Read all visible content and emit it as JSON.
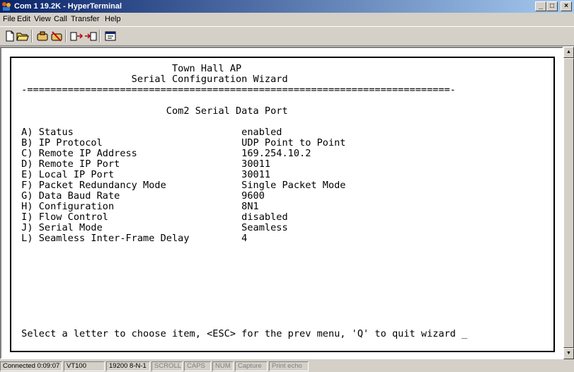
{
  "window": {
    "title": "Com 1 19.2K - HyperTerminal",
    "minimize_glyph": "_",
    "maximize_glyph": "□",
    "close_glyph": "×"
  },
  "menu": [
    "File",
    "Edit",
    "View",
    "Call",
    "Transfer",
    "Help"
  ],
  "toolbar": {
    "buttons": [
      "new-icon",
      "open-icon",
      "connect-icon",
      "disconnect-icon",
      "send-icon",
      "receive-icon",
      "properties-icon"
    ]
  },
  "terminal": {
    "lines": [
      "                           Town Hall AP",
      "                    Serial Configuration Wizard",
      " -=========================================================================-",
      "",
      "                          Com2 Serial Data Port",
      "",
      " A) Status                             enabled",
      " B) IP Protocol                        UDP Point to Point",
      " C) Remote IP Address                  169.254.10.2",
      " D) Remote IP Port                     30011",
      " E) Local IP Port                      30011",
      " F) Packet Redundancy Mode             Single Packet Mode",
      " G) Data Baud Rate                     9600",
      " H) Configuration                      8N1",
      " I) Flow Control                       disabled",
      " J) Serial Mode                        Seamless",
      " L) Seamless Inter-Frame Delay         4",
      "",
      "",
      "",
      "",
      "",
      "",
      "",
      "",
      " Select a letter to choose item, <ESC> for the prev menu, 'Q' to quit wizard _"
    ]
  },
  "scrollbar": {
    "up_glyph": "▲",
    "down_glyph": "▼"
  },
  "status": {
    "connected": "Connected 0:09:07",
    "emulation": "VT100",
    "settings": "19200 8-N-1",
    "scroll": "SCROLL",
    "caps": "CAPS",
    "num": "NUM",
    "capture": "Capture",
    "print_echo": "Print echo"
  }
}
